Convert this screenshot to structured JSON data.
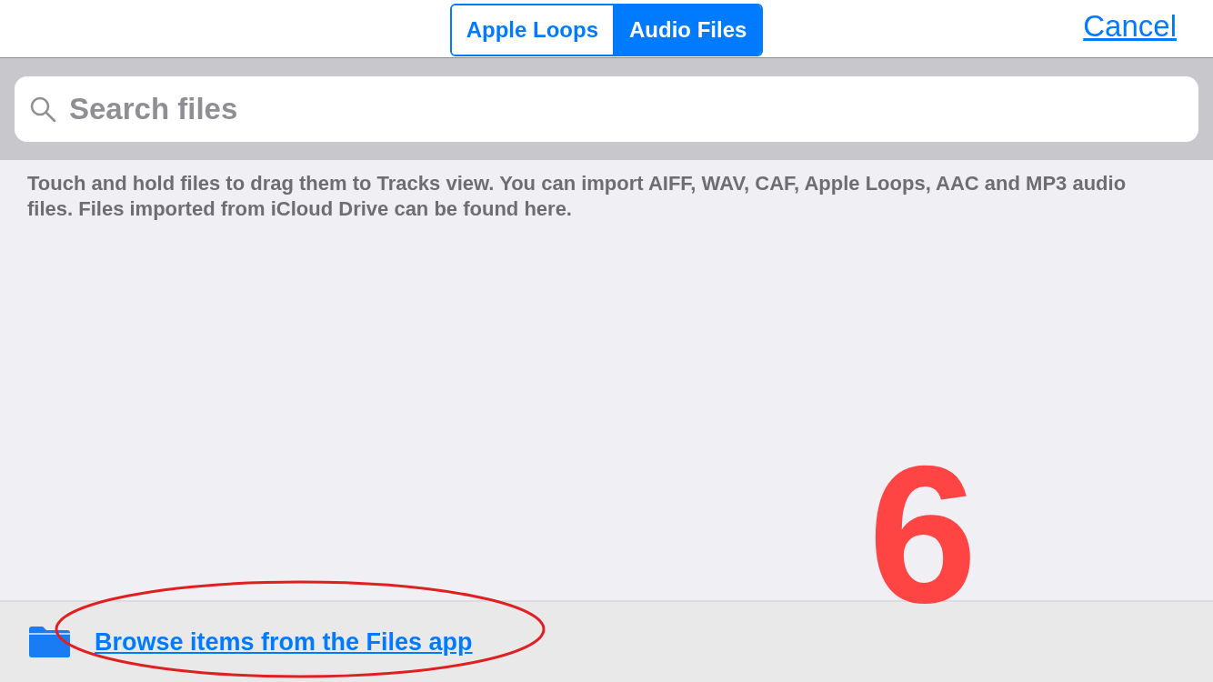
{
  "segments": [
    {
      "label": "Apple Loops",
      "selected": false
    },
    {
      "label": "Audio Files",
      "selected": true
    }
  ],
  "cancel": "Cancel",
  "search": {
    "placeholder": "Search files"
  },
  "hint": "Touch and hold files to drag them to Tracks view. You can import AIFF, WAV, CAF, Apple Loops, AAC and MP3 audio files. Files imported from iCloud Drive can be found here.",
  "footer": {
    "link": "Browse items from the Files app"
  },
  "annotation": {
    "step": "6"
  }
}
